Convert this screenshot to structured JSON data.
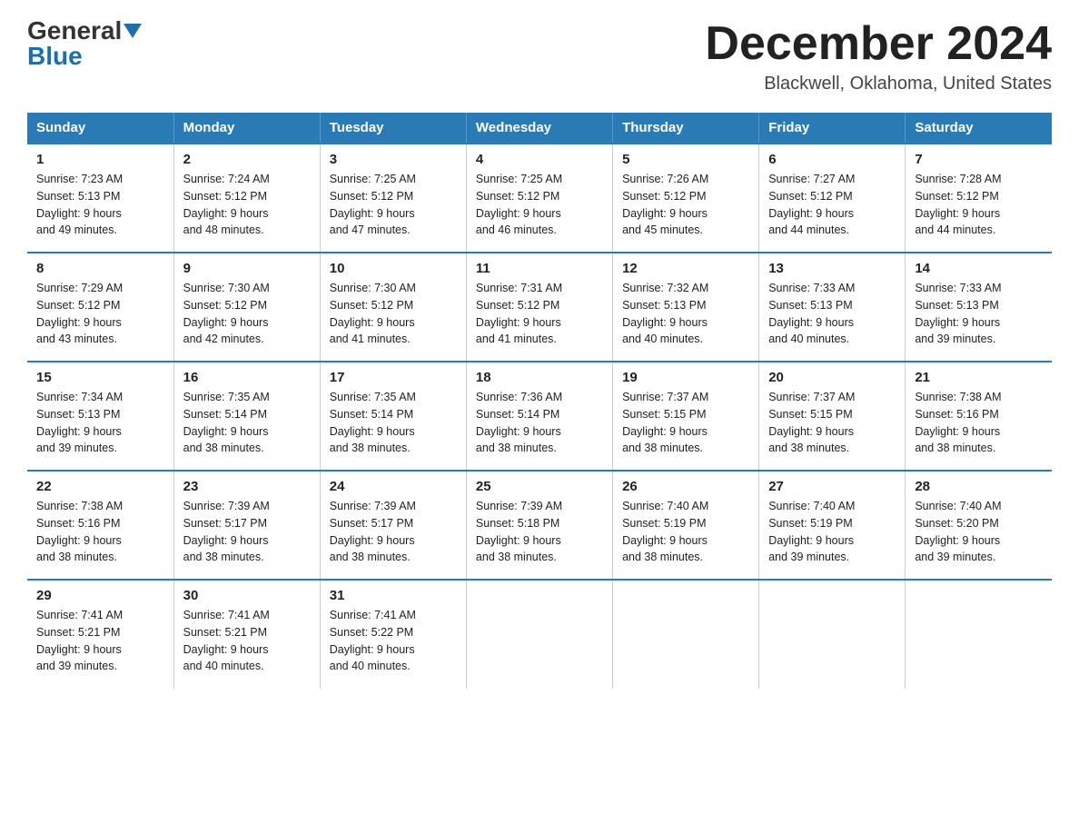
{
  "logo": {
    "general": "General",
    "blue": "Blue"
  },
  "title": "December 2024",
  "location": "Blackwell, Oklahoma, United States",
  "headers": [
    "Sunday",
    "Monday",
    "Tuesday",
    "Wednesday",
    "Thursday",
    "Friday",
    "Saturday"
  ],
  "weeks": [
    [
      {
        "day": "1",
        "sunrise": "7:23 AM",
        "sunset": "5:13 PM",
        "daylight": "9 hours and 49 minutes."
      },
      {
        "day": "2",
        "sunrise": "7:24 AM",
        "sunset": "5:12 PM",
        "daylight": "9 hours and 48 minutes."
      },
      {
        "day": "3",
        "sunrise": "7:25 AM",
        "sunset": "5:12 PM",
        "daylight": "9 hours and 47 minutes."
      },
      {
        "day": "4",
        "sunrise": "7:25 AM",
        "sunset": "5:12 PM",
        "daylight": "9 hours and 46 minutes."
      },
      {
        "day": "5",
        "sunrise": "7:26 AM",
        "sunset": "5:12 PM",
        "daylight": "9 hours and 45 minutes."
      },
      {
        "day": "6",
        "sunrise": "7:27 AM",
        "sunset": "5:12 PM",
        "daylight": "9 hours and 44 minutes."
      },
      {
        "day": "7",
        "sunrise": "7:28 AM",
        "sunset": "5:12 PM",
        "daylight": "9 hours and 44 minutes."
      }
    ],
    [
      {
        "day": "8",
        "sunrise": "7:29 AM",
        "sunset": "5:12 PM",
        "daylight": "9 hours and 43 minutes."
      },
      {
        "day": "9",
        "sunrise": "7:30 AM",
        "sunset": "5:12 PM",
        "daylight": "9 hours and 42 minutes."
      },
      {
        "day": "10",
        "sunrise": "7:30 AM",
        "sunset": "5:12 PM",
        "daylight": "9 hours and 41 minutes."
      },
      {
        "day": "11",
        "sunrise": "7:31 AM",
        "sunset": "5:12 PM",
        "daylight": "9 hours and 41 minutes."
      },
      {
        "day": "12",
        "sunrise": "7:32 AM",
        "sunset": "5:13 PM",
        "daylight": "9 hours and 40 minutes."
      },
      {
        "day": "13",
        "sunrise": "7:33 AM",
        "sunset": "5:13 PM",
        "daylight": "9 hours and 40 minutes."
      },
      {
        "day": "14",
        "sunrise": "7:33 AM",
        "sunset": "5:13 PM",
        "daylight": "9 hours and 39 minutes."
      }
    ],
    [
      {
        "day": "15",
        "sunrise": "7:34 AM",
        "sunset": "5:13 PM",
        "daylight": "9 hours and 39 minutes."
      },
      {
        "day": "16",
        "sunrise": "7:35 AM",
        "sunset": "5:14 PM",
        "daylight": "9 hours and 38 minutes."
      },
      {
        "day": "17",
        "sunrise": "7:35 AM",
        "sunset": "5:14 PM",
        "daylight": "9 hours and 38 minutes."
      },
      {
        "day": "18",
        "sunrise": "7:36 AM",
        "sunset": "5:14 PM",
        "daylight": "9 hours and 38 minutes."
      },
      {
        "day": "19",
        "sunrise": "7:37 AM",
        "sunset": "5:15 PM",
        "daylight": "9 hours and 38 minutes."
      },
      {
        "day": "20",
        "sunrise": "7:37 AM",
        "sunset": "5:15 PM",
        "daylight": "9 hours and 38 minutes."
      },
      {
        "day": "21",
        "sunrise": "7:38 AM",
        "sunset": "5:16 PM",
        "daylight": "9 hours and 38 minutes."
      }
    ],
    [
      {
        "day": "22",
        "sunrise": "7:38 AM",
        "sunset": "5:16 PM",
        "daylight": "9 hours and 38 minutes."
      },
      {
        "day": "23",
        "sunrise": "7:39 AM",
        "sunset": "5:17 PM",
        "daylight": "9 hours and 38 minutes."
      },
      {
        "day": "24",
        "sunrise": "7:39 AM",
        "sunset": "5:17 PM",
        "daylight": "9 hours and 38 minutes."
      },
      {
        "day": "25",
        "sunrise": "7:39 AM",
        "sunset": "5:18 PM",
        "daylight": "9 hours and 38 minutes."
      },
      {
        "day": "26",
        "sunrise": "7:40 AM",
        "sunset": "5:19 PM",
        "daylight": "9 hours and 38 minutes."
      },
      {
        "day": "27",
        "sunrise": "7:40 AM",
        "sunset": "5:19 PM",
        "daylight": "9 hours and 39 minutes."
      },
      {
        "day": "28",
        "sunrise": "7:40 AM",
        "sunset": "5:20 PM",
        "daylight": "9 hours and 39 minutes."
      }
    ],
    [
      {
        "day": "29",
        "sunrise": "7:41 AM",
        "sunset": "5:21 PM",
        "daylight": "9 hours and 39 minutes."
      },
      {
        "day": "30",
        "sunrise": "7:41 AM",
        "sunset": "5:21 PM",
        "daylight": "9 hours and 40 minutes."
      },
      {
        "day": "31",
        "sunrise": "7:41 AM",
        "sunset": "5:22 PM",
        "daylight": "9 hours and 40 minutes."
      },
      null,
      null,
      null,
      null
    ]
  ]
}
